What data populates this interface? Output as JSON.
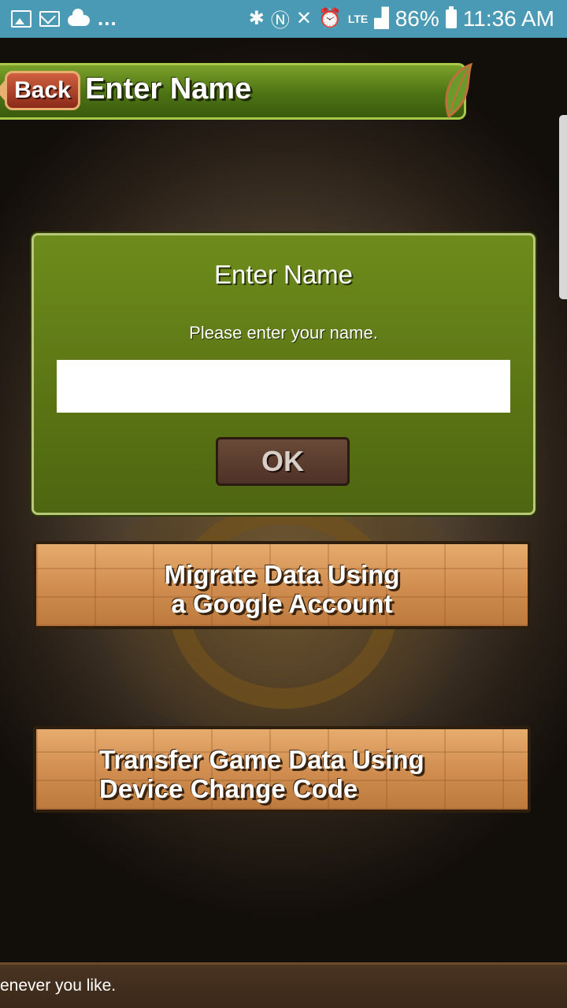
{
  "status_bar": {
    "left_icons": [
      "image-icon",
      "mail-icon",
      "cloud-icon"
    ],
    "more": "...",
    "right_icons": [
      "bluetooth-icon",
      "nfc-icon",
      "mute-icon",
      "alarm-icon",
      "lte-icon",
      "signal-icon"
    ],
    "battery": "86%",
    "time": "11:36 AM"
  },
  "header": {
    "back_label": "Back",
    "title": "Enter Name"
  },
  "dialog": {
    "title": "Enter Name",
    "message": "Please enter your name.",
    "input_value": "",
    "ok_label": "OK"
  },
  "buttons": {
    "google": [
      "Migrate Data Using",
      "a Google Account"
    ],
    "transfer": [
      "Transfer Game Data Using",
      "Device Change Code"
    ]
  },
  "ticker": "enever you like.",
  "colors": {
    "status_bar": "#4a9ab6",
    "header_green": "#5a8018",
    "dialog_green": "#647e18",
    "stone": "#d8995a"
  }
}
